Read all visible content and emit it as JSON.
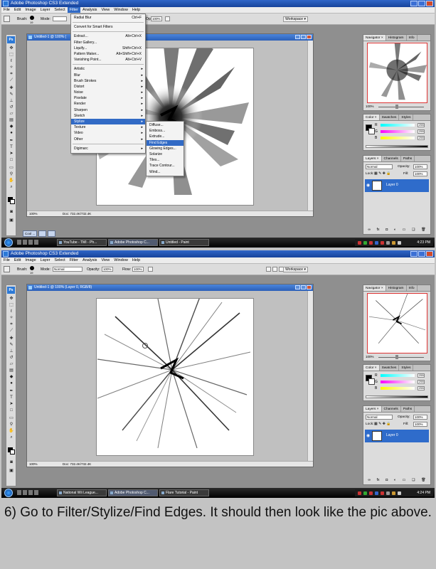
{
  "app": {
    "title": "Adobe Photoshop CS3 Extended",
    "menu": [
      "File",
      "Edit",
      "Image",
      "Layer",
      "Select",
      "Filter",
      "Analysis",
      "View",
      "Window",
      "Help"
    ],
    "brush_label": "Brush:",
    "brush_size": "19",
    "mode_label": "Mode:",
    "mode_value": "Normal",
    "opacity_label": "Opacity:",
    "opacity_value": "100%",
    "flow_label": "Flow:",
    "flow_value": "100%",
    "workspace_label": "Workspace ▾",
    "toolbox_logo": "Ps"
  },
  "shot1": {
    "doc_title": "Untitled-1 @ 100% (",
    "zoom": "100%",
    "doc_size": "Doc: 732.4K/732.4K",
    "filter_menu": {
      "items": [
        {
          "label": "Radial Blur",
          "shortcut": "Ctrl+F"
        },
        {
          "label": "Convert for Smart Filters",
          "shortcut": ""
        },
        {
          "label": "Extract...",
          "shortcut": "Alt+Ctrl+X"
        },
        {
          "label": "Filter Gallery...",
          "shortcut": ""
        },
        {
          "label": "Liquify...",
          "shortcut": "Shift+Ctrl+X"
        },
        {
          "label": "Pattern Maker...",
          "shortcut": "Alt+Shift+Ctrl+X"
        },
        {
          "label": "Vanishing Point...",
          "shortcut": "Alt+Ctrl+V"
        },
        {
          "label": "Artistic"
        },
        {
          "label": "Blur"
        },
        {
          "label": "Brush Strokes"
        },
        {
          "label": "Distort"
        },
        {
          "label": "Noise"
        },
        {
          "label": "Pixelate"
        },
        {
          "label": "Render"
        },
        {
          "label": "Sharpen"
        },
        {
          "label": "Sketch"
        },
        {
          "label": "Stylize"
        },
        {
          "label": "Texture"
        },
        {
          "label": "Video"
        },
        {
          "label": "Other"
        },
        {
          "label": "Digimarc"
        }
      ]
    },
    "stylize_menu": [
      "Diffuse...",
      "Emboss...",
      "Extrude...",
      "Find Edges",
      "Glowing Edges...",
      "Solarize",
      "Tiles...",
      "Trace Contour...",
      "Wind..."
    ],
    "taskbar": [
      "YouTube - TMI - Ph...",
      "Adobe Photoshop C...",
      "Untitled - Paint"
    ],
    "clock": "4:23 PM",
    "minidoc": "Cool ..."
  },
  "shot2": {
    "doc_title": "Untitled-1 @ 100% (Layer 0, RGB/8)",
    "zoom": "100%",
    "doc_size": "Doc: 732.4K/732.4K",
    "taskbar": [
      "National Wii League...",
      "Adobe Photoshop C...",
      "Flare Tutorial - Paint"
    ],
    "clock": "4:24 PM"
  },
  "panels": {
    "nav_tabs": [
      "Navigator ×",
      "Histogram",
      "Info"
    ],
    "nav_zoom": "100%",
    "color_tabs": [
      "Color ×",
      "Swatches",
      "Styles"
    ],
    "rgb": [
      {
        "c": "R",
        "v": "255"
      },
      {
        "c": "G",
        "v": "255"
      },
      {
        "c": "B",
        "v": "255"
      }
    ],
    "layer_tabs": [
      "Layers ×",
      "Channels",
      "Paths"
    ],
    "blend": "Normal",
    "opacity_label": "Opacity:",
    "opacity": "100%",
    "lock_label": "Lock:",
    "fill_label": "Fill:",
    "fill": "100%",
    "layer_name": "Layer 0"
  },
  "caption": "6) Go to Filter/Stylize/Find Edges. It should then look like the pic above."
}
